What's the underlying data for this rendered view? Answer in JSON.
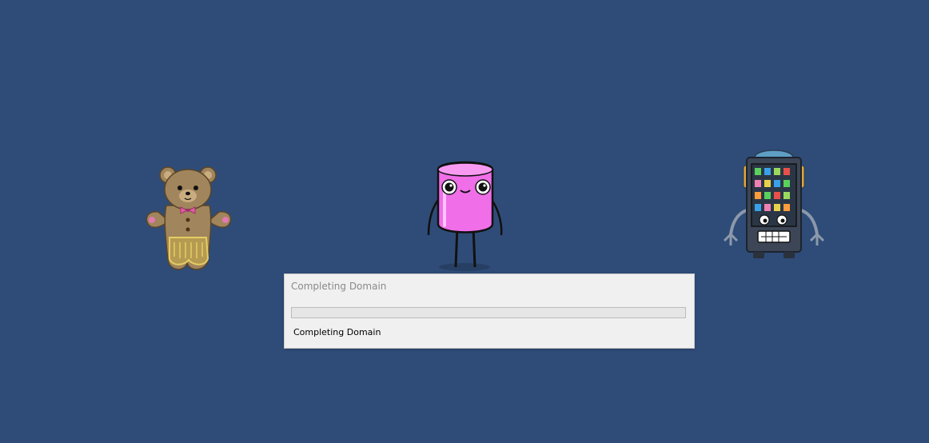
{
  "background_color": "#2f4c78",
  "characters": [
    {
      "name": "gingerbread-bear",
      "icon": "gingerbread-bear-icon"
    },
    {
      "name": "marshmallow",
      "icon": "marshmallow-icon"
    },
    {
      "name": "vending-machine-robot",
      "icon": "vending-robot-icon"
    }
  ],
  "dialog": {
    "title": "Completing Domain",
    "progress_fraction": 0,
    "status_text": "Completing Domain"
  }
}
